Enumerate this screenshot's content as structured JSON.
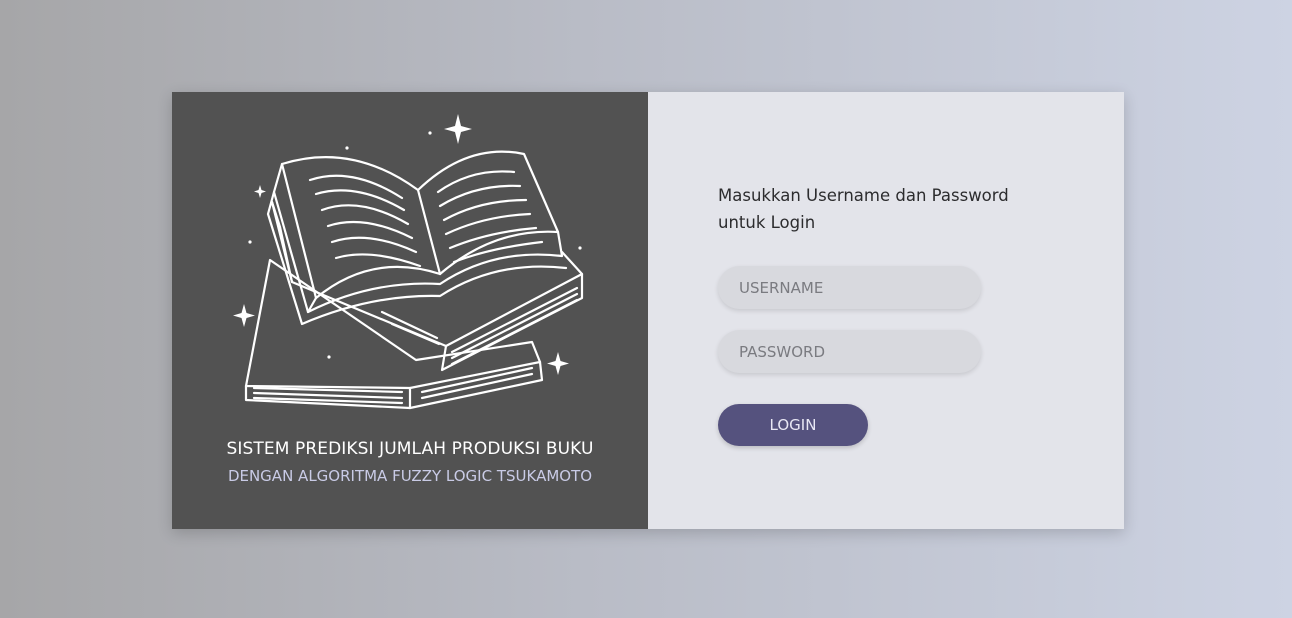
{
  "branding": {
    "illustration_icon": "open-books-stack-icon",
    "title": "SISTEM PREDIKSI JUMLAH PRODUKSI BUKU",
    "subtitle": "DENGAN ALGORITMA FUZZY LOGIC TSUKAMOTO"
  },
  "login_form": {
    "prompt": "Masukkan Username dan Password untuk Login",
    "username_placeholder": "USERNAME",
    "username_value": "",
    "password_placeholder": "PASSWORD",
    "password_value": "",
    "submit_label": "LOGIN"
  },
  "colors": {
    "left_panel_bg": "#525252",
    "right_panel_bg": "#e3e4ea",
    "button_bg": "#55527e",
    "subtitle_text": "#c9cbe6"
  }
}
